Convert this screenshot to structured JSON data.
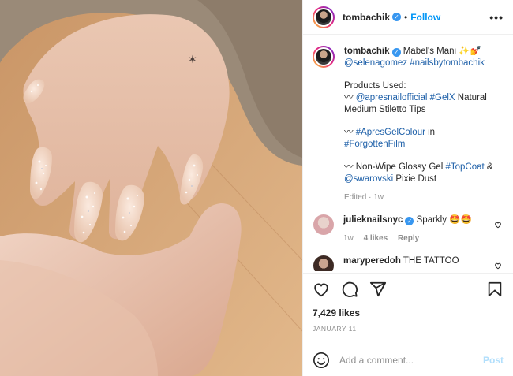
{
  "post": {
    "username": "tombachik",
    "follow_label": "Follow",
    "more_label": "•••",
    "dot": "•",
    "verified_mark": "✓"
  },
  "caption": {
    "username": "tombachik",
    "title": "Mabel's Mani ✨💅",
    "tags1": "@selenagomez #nailsbytombachik",
    "products_heading": "Products Used:",
    "line1_prefix": "〰",
    "line1_link": "@apresnailofficial #GelX",
    "line1_rest": " Natural Medium Stiletto Tips",
    "line2_prefix": "〰",
    "line2_link": "#ApresGelColour",
    "line2_mid": " in",
    "line2_link2": "#ForgottenFilm",
    "line3_prefix": "〰",
    "line3_text": " Non-Wipe Glossy Gel ",
    "line3_link": "#TopCoat",
    "line3_amp": " &",
    "line3_link2": "@swarovski",
    "line3_rest": " Pixie Dust",
    "meta": "Edited · 1w"
  },
  "comments": [
    {
      "username": "julieknailsnyc",
      "verified": true,
      "text": "Sparkly 🤩🤩",
      "time": "1w",
      "likes": "4 likes",
      "reply": "Reply"
    },
    {
      "username": "maryperedoh",
      "verified": false,
      "text": "THE TATTOO"
    }
  ],
  "stats": {
    "likes": "7,429 likes",
    "date": "JANUARY 11"
  },
  "composer": {
    "placeholder": "Add a comment...",
    "post_label": "Post"
  },
  "icons": [
    "heart-icon",
    "comment-icon",
    "share-icon",
    "bookmark-icon",
    "emoji-icon",
    "more-icon",
    "verified-icon"
  ],
  "colors": {
    "link": "#1d5fa8",
    "follow": "#0095f6",
    "post_disabled": "#b2dffc",
    "muted": "#8e8e8e"
  }
}
